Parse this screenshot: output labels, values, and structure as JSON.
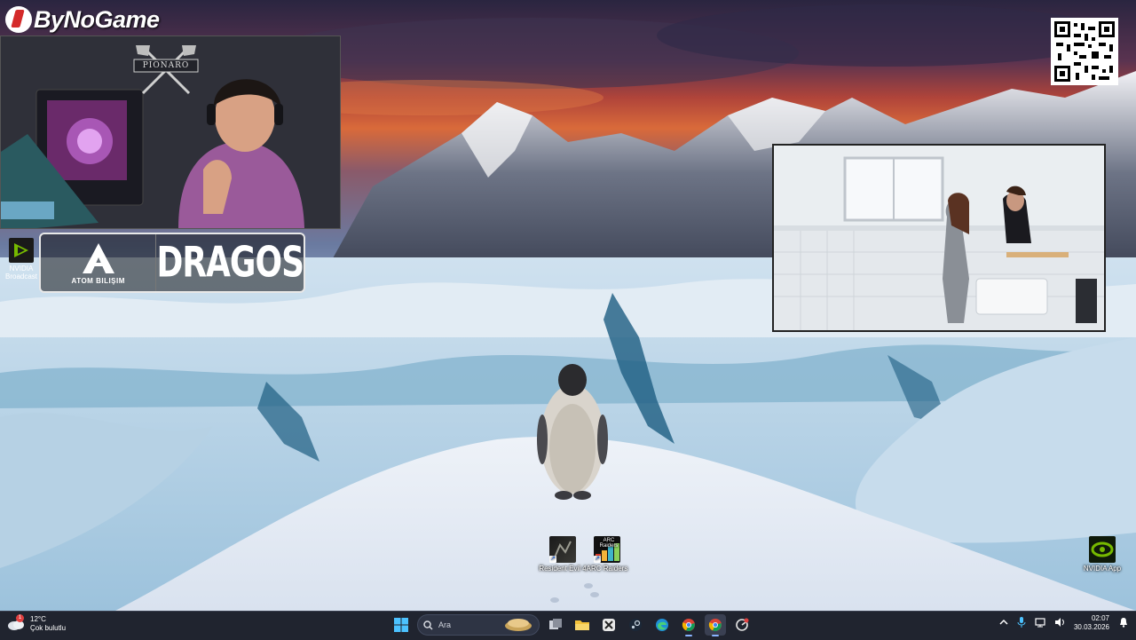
{
  "overlay": {
    "brand": "ByNoGame",
    "webcam_banner": "PIONARO",
    "nvidia_broadcast_label": "NVIDIA Broadcast",
    "sponsor_left": "ATOM BILIŞIM",
    "sponsor_right": "DRAGOS"
  },
  "desktop": {
    "icons": [
      {
        "label": "Resident Evil 4",
        "icon": "resident-evil-icon"
      },
      {
        "label": "ARC Raiders",
        "icon": "arc-raiders-icon"
      },
      {
        "label": "NVIDIA App",
        "icon": "nvidia-app-icon"
      }
    ],
    "arc_thumb_text": "ARC Raiders"
  },
  "taskbar": {
    "weather": {
      "temp": "12°C",
      "desc": "Çok bulutlu",
      "badge": "1"
    },
    "search_placeholder": "Ara",
    "apps": [
      "start-icon",
      "search-icon",
      "widget-icon",
      "task-view-icon",
      "file-explorer-icon",
      "xbox-icon",
      "steam-icon",
      "edge-icon",
      "chrome-icon",
      "chrome-profile-icon",
      "app-icon"
    ],
    "clock": {
      "time": "02:07",
      "date": "30.03.2026"
    }
  },
  "colors": {
    "accent": "#2a6ee6",
    "taskbar_bg": "#202430",
    "nvidia_green": "#76b900",
    "brand_red": "#d42a2a"
  }
}
